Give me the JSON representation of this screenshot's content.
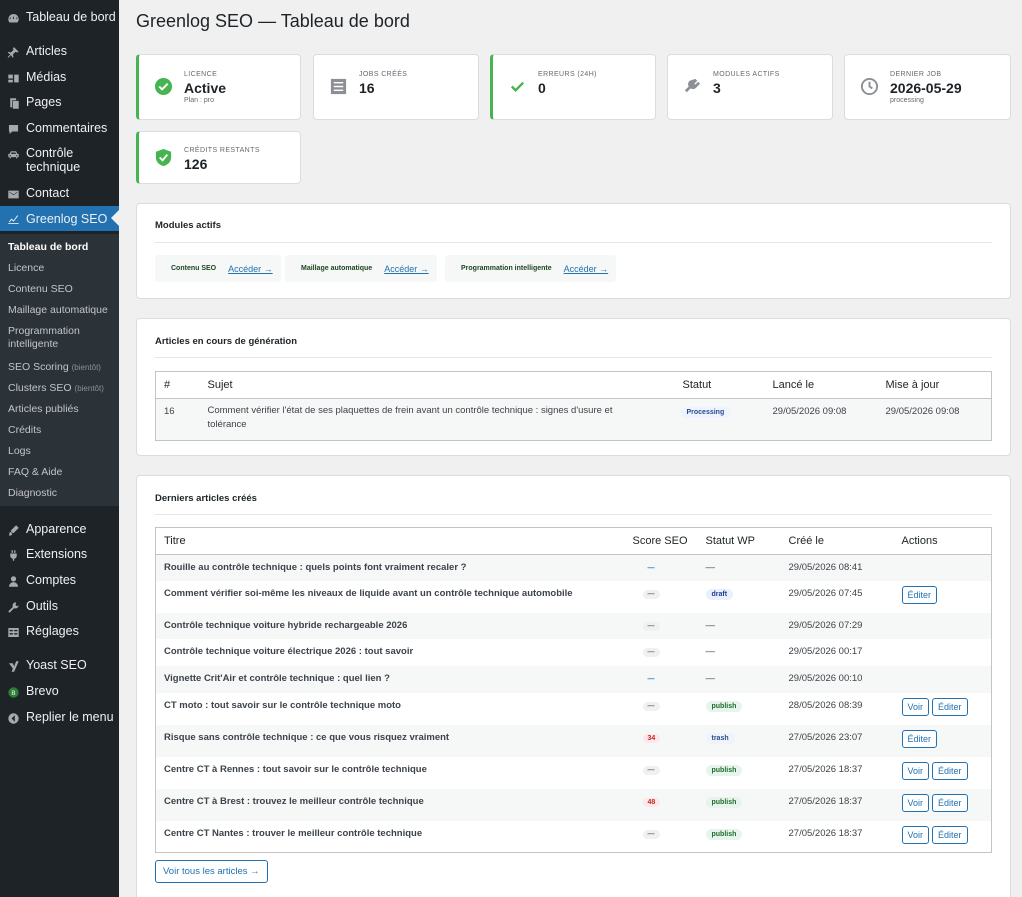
{
  "menu": {
    "dashboard": "Tableau de bord",
    "articles": "Articles",
    "medias": "Médias",
    "pages": "Pages",
    "comments": "Commentaires",
    "controle_line1": "Contrôle",
    "controle_line2": "technique",
    "contact": "Contact",
    "greenlog": "Greenlog SEO",
    "apparence": "Apparence",
    "extensions": "Extensions",
    "comptes": "Comptes",
    "outils": "Outils",
    "reglages": "Réglages",
    "yoast": "Yoast SEO",
    "brevo": "Brevo",
    "collapse": "Replier le menu"
  },
  "submenu": {
    "tableau": "Tableau de bord",
    "licence": "Licence",
    "contenu": "Contenu SEO",
    "maillage": "Maillage automatique",
    "programmation": "Programmation intelligente",
    "scoring": "SEO Scoring",
    "scoring_soon": "(bientôt)",
    "clusters": "Clusters SEO",
    "clusters_soon": "(bientôt)",
    "publies": "Articles publiés",
    "credits": "Crédits",
    "logs": "Logs",
    "faq": "FAQ & Aide",
    "diagnostic": "Diagnostic"
  },
  "page_title": "Greenlog SEO — Tableau de bord",
  "cards": {
    "licence": {
      "label": "Licence",
      "value": "Active",
      "sub": "Plan : pro"
    },
    "jobs": {
      "label": "Jobs créés",
      "value": "16"
    },
    "errors": {
      "label": "Erreurs (24h)",
      "value": "0"
    },
    "modules": {
      "label": "Modules actifs",
      "value": "3"
    },
    "lastjob": {
      "label": "Dernier job",
      "value": "2026-05-29",
      "sub": "processing"
    },
    "credits": {
      "label": "Crédits restants",
      "value": "126"
    }
  },
  "modules_panel": {
    "title": "Modules actifs",
    "link_label": "Accéder →",
    "items": [
      "Contenu SEO",
      "Maillage automatique",
      "Programmation intelligente"
    ]
  },
  "jobs_panel": {
    "title": "Articles en cours de génération",
    "headers": [
      "#",
      "Sujet",
      "Statut",
      "Lancé le",
      "Mise à jour"
    ],
    "row": {
      "id": "16",
      "subject": "Comment vérifier l'état de ses plaquettes de frein avant un contrôle technique : signes d'usure et tolérance",
      "status": "Processing",
      "launched": "29/05/2026 09:08",
      "updated": "29/05/2026 09:08"
    }
  },
  "articles_panel": {
    "title": "Derniers articles créés",
    "headers": [
      "Titre",
      "Score SEO",
      "Statut WP",
      "Créé le",
      "Actions"
    ],
    "view_label": "Voir",
    "edit_label": "Éditer",
    "all_button": "Voir tous les articles →",
    "rows": [
      {
        "title": "Rouille au contrôle technique : quels points font vraiment recaler ?",
        "score": "—",
        "score_style": "blue",
        "status": "—",
        "status_style": "",
        "date": "29/05/2026 08:41",
        "actions": ""
      },
      {
        "title": "Comment vérifier soi-même les niveaux de liquide avant un contrôle technique automobile",
        "score": "—",
        "score_style": "gray",
        "status": "draft",
        "status_style": "draft",
        "date": "29/05/2026 07:45",
        "actions": "edit"
      },
      {
        "title": "Contrôle technique voiture hybride rechargeable 2026",
        "score": "—",
        "score_style": "gray",
        "status": "—",
        "status_style": "",
        "date": "29/05/2026 07:29",
        "actions": ""
      },
      {
        "title": "Contrôle technique voiture électrique 2026 : tout savoir",
        "score": "—",
        "score_style": "gray",
        "status": "—",
        "status_style": "",
        "date": "29/05/2026 00:17",
        "actions": ""
      },
      {
        "title": "Vignette Crit'Air et contrôle technique : quel lien ?",
        "score": "—",
        "score_style": "blue",
        "status": "—",
        "status_style": "",
        "date": "29/05/2026 00:10",
        "actions": ""
      },
      {
        "title": "CT moto : tout savoir sur le contrôle technique moto",
        "score": "—",
        "score_style": "gray",
        "status": "publish",
        "status_style": "publish",
        "date": "28/05/2026 08:39",
        "actions": "view-edit"
      },
      {
        "title": "Risque sans contrôle technique : ce que vous risquez vraiment",
        "score": "34",
        "score_style": "red",
        "status": "trash",
        "status_style": "trash",
        "date": "27/05/2026 23:07",
        "actions": "edit"
      },
      {
        "title": "Centre CT à Rennes : tout savoir sur le contrôle technique",
        "score": "—",
        "score_style": "gray",
        "status": "publish",
        "status_style": "publish",
        "date": "27/05/2026 18:37",
        "actions": "view-edit"
      },
      {
        "title": "Centre CT à Brest : trouvez le meilleur contrôle technique",
        "score": "48",
        "score_style": "red",
        "status": "publish",
        "status_style": "publish",
        "date": "27/05/2026 18:37",
        "actions": "view-edit"
      },
      {
        "title": "Centre CT Nantes : trouver le meilleur contrôle technique",
        "score": "—",
        "score_style": "gray",
        "status": "publish",
        "status_style": "publish",
        "date": "27/05/2026 18:37",
        "actions": "view-edit"
      }
    ]
  },
  "colors": {
    "sidebar_bg": "#1d2327",
    "submenu_bg": "#2c3338",
    "accent": "#2271b1",
    "success": "#46b450",
    "error": "#c62828"
  }
}
